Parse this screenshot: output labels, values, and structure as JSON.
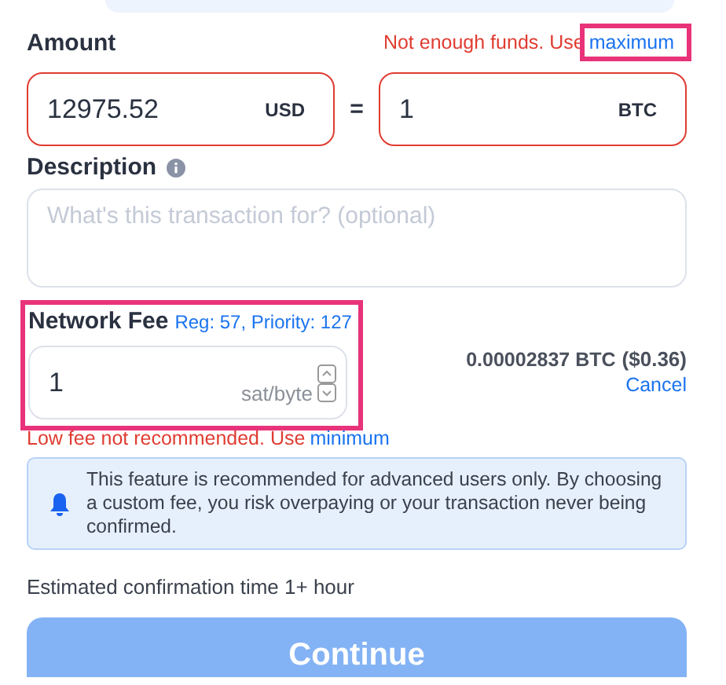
{
  "amount": {
    "label": "Amount",
    "error_text": "Not enough funds. Use",
    "error_link": {
      "label": "maximum",
      "highlighted": true
    },
    "fields": [
      {
        "value": "12975.52",
        "unit": "USD",
        "error": true
      },
      {
        "value": "1",
        "unit": "BTC",
        "error": true
      }
    ],
    "separator": "="
  },
  "description": {
    "label": "Description",
    "placeholder": "What's this transaction for? (optional)"
  },
  "network_fee": {
    "label": "Network Fee",
    "hint": "Reg: 57, Priority: 127",
    "highlighted": true,
    "value": "1",
    "unit": "sat/byte",
    "fee_amount": "0.00002837 BTC",
    "fee_fiat": "($0.36)",
    "cancel": "Cancel",
    "warning_text": "Low fee not recommended. Use",
    "warning_link": "minimum"
  },
  "notice": "This feature is recommended for advanced users only. By choosing a custom fee, you risk overpaying or your transaction never being confirmed.",
  "estimate": "Estimated confirmation time 1+ hour",
  "continue_button": {
    "label": "Continue",
    "disabled": true
  }
}
